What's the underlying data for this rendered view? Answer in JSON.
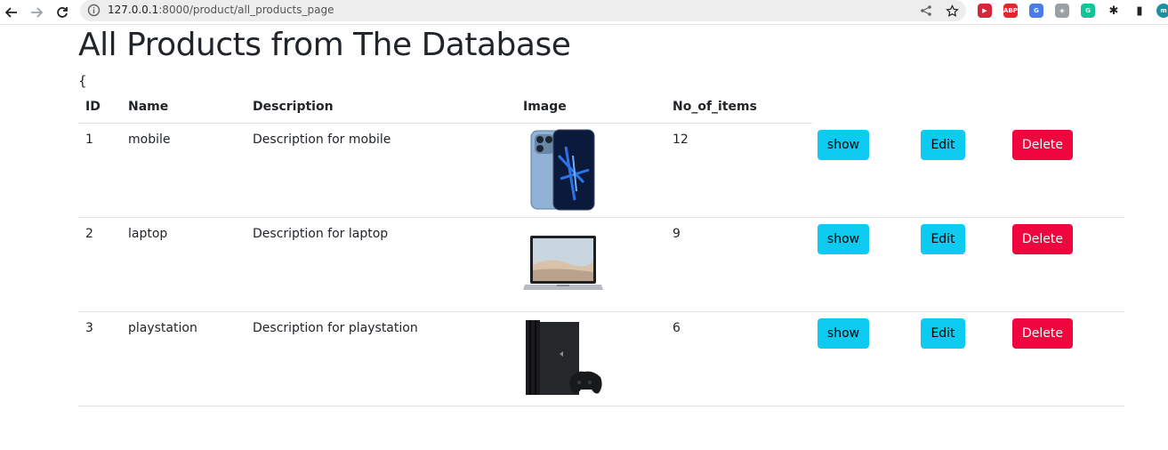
{
  "browser": {
    "url_host": "127.0.0.1",
    "url_rest": ":8000/product/all_products_page",
    "extensions": [
      {
        "name": "video-ext-icon",
        "color": "#d6263b",
        "glyph": "▶"
      },
      {
        "name": "adblock-icon",
        "color": "#e5252c",
        "glyph": "ABP"
      },
      {
        "name": "translate-icon",
        "color": "#4a7de8",
        "glyph": "G"
      },
      {
        "name": "shield-ext-icon",
        "color": "#9aa0a6",
        "glyph": "◈"
      },
      {
        "name": "grammarly-icon",
        "color": "#15c39a",
        "glyph": "G"
      },
      {
        "name": "puzzle-icon",
        "color": "#202124",
        "glyph": "✱"
      },
      {
        "name": "sidepanel-icon",
        "color": "#202124",
        "glyph": "▮"
      },
      {
        "name": "profile-avatar",
        "color": "#1f8fa0",
        "glyph": "m"
      }
    ]
  },
  "page": {
    "title": "All Products from The Database",
    "stray_text": "{"
  },
  "table": {
    "headers": {
      "id": "ID",
      "name": "Name",
      "description": "Description",
      "image": "Image",
      "count": "No_of_items"
    },
    "rows": [
      {
        "id": "1",
        "name": "mobile",
        "description": "Description for mobile",
        "image": "phone",
        "count": "12"
      },
      {
        "id": "2",
        "name": "laptop",
        "description": "Description for laptop",
        "image": "laptop",
        "count": "9"
      },
      {
        "id": "3",
        "name": "playstation",
        "description": "Description for playstation",
        "image": "console",
        "count": "6"
      }
    ],
    "actions": {
      "show": "show",
      "edit": "Edit",
      "delete": "Delete"
    }
  },
  "colors": {
    "info": "#0dcaf0",
    "danger": "#f0063f"
  }
}
